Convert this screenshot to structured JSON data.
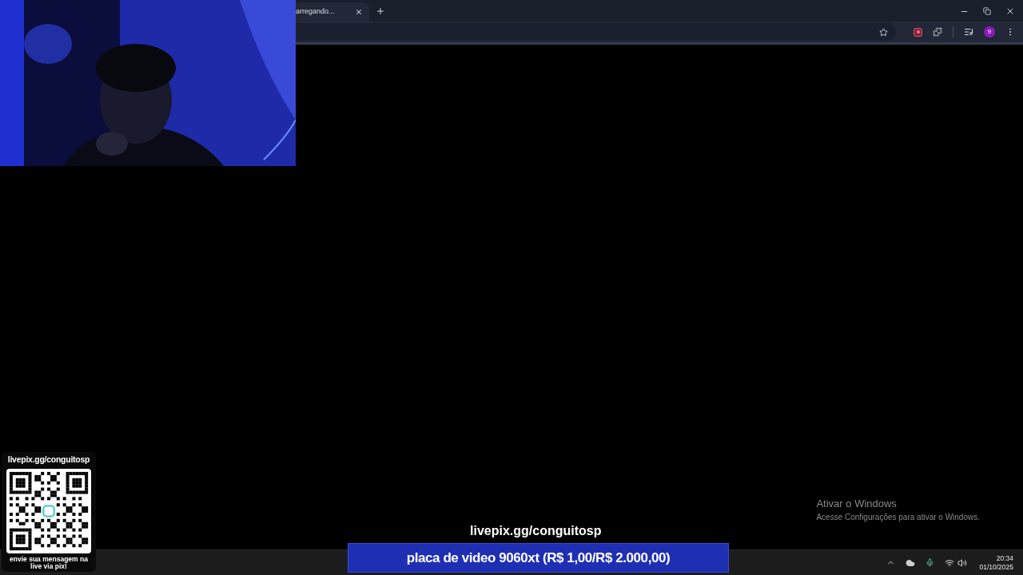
{
  "browser": {
    "tabs": [
      {
        "title": "arregando...",
        "selected": true
      }
    ],
    "profile_badge": "9"
  },
  "qr_card": {
    "url": "livepix.gg/conguitosp",
    "caption": "envie sua mensagem na live via pix!"
  },
  "stream_link": "livepix.gg/conguitosp",
  "donation_banner": "placa de video 9060xt (R$ 1,00/R$ 2.000,00)",
  "activation_notice": {
    "title": "Ativar o Windows",
    "subtitle": "Acesse Configurações para ativar o Windows."
  },
  "taskbar": {
    "time": "20:34",
    "date": "01/10/2025"
  }
}
